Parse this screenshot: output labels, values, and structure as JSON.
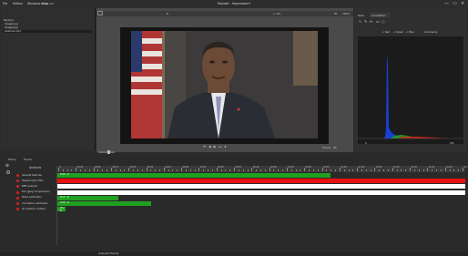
{
  "window": {
    "title": "Mandet - Impression*",
    "menu": [
      "File",
      "Edition",
      "Windows",
      "Help"
    ],
    "controls": [
      "—",
      "▭",
      "×"
    ]
  },
  "explorer": {
    "header": "Media Info",
    "section": "Explorer",
    "items": [
      {
        "label": "image1.jpg",
        "selected": false
      },
      {
        "label": "image2.jpg",
        "selected": false
      },
      {
        "label": "example.mp4",
        "selected": true
      }
    ]
  },
  "viewer": {
    "zoom_label": "8",
    "center_label": "x: 1/5",
    "fit_label": "Fit",
    "zoom_percent": "100%",
    "transport": [
      "⏮",
      "◀",
      "▶",
      "⏭",
      "⏹"
    ],
    "frame_label": "Frame",
    "frame_value": "80"
  },
  "right_panel": {
    "tabs": [
      "Data",
      "Annotation"
    ],
    "toolbar_icons": [
      "pointer-icon",
      "pen-icon",
      "pencil-icon",
      "rect-icon",
      "circle-icon"
    ],
    "checks": [
      "Red",
      "Green",
      "Blue",
      "Luminance"
    ],
    "hist_axis": {
      "min_label": "0",
      "max_label": "255"
    }
  },
  "bottom_panel": {
    "tabs": [
      "Filters",
      "Tracks"
    ],
    "analysis_label": "Analysis",
    "ruler_labels": [
      "0",
      "00:04",
      "00:08",
      "00:12",
      "00:16",
      "00:20",
      "00:24",
      "00:28",
      "00:32",
      "00:36",
      "00:40",
      "00:44",
      "00:48",
      "00:52",
      "00:56",
      "01:00",
      "01:04",
      "01:08",
      "01:12",
      "01:16",
      "01:20",
      "01:24",
      "01:28",
      "01:32"
    ],
    "rows": [
      {
        "label": "General features",
        "color": "#1fa020",
        "value": 0.67,
        "text": "0.68 · N"
      },
      {
        "label": "Steganalysis (flat)",
        "color": "#e81010",
        "value": 1.0,
        "text": ""
      },
      {
        "label": "BMS analysis",
        "color": "#ffffff",
        "value": 1.0,
        "text": ""
      },
      {
        "label": "ELA (Jpeg compression)",
        "color": "#ffffff",
        "value": 1.0,
        "text": ""
      },
      {
        "label": "Noise estimation",
        "color": "#1fa020",
        "value": 0.15,
        "text": "0.25 · N"
      },
      {
        "label": "Correlation estimation",
        "color": "#1fa020",
        "value": 0.23,
        "text": "0.26 · N"
      },
      {
        "label": "JS mutation method",
        "color": "#1fa020",
        "value": 0.02,
        "text": "2% · N"
      }
    ]
  },
  "status": {
    "text": "Analyzed   Ready"
  },
  "colors": {
    "green": "#1fa020",
    "red": "#e81010",
    "blue": "#1a3fd6"
  }
}
